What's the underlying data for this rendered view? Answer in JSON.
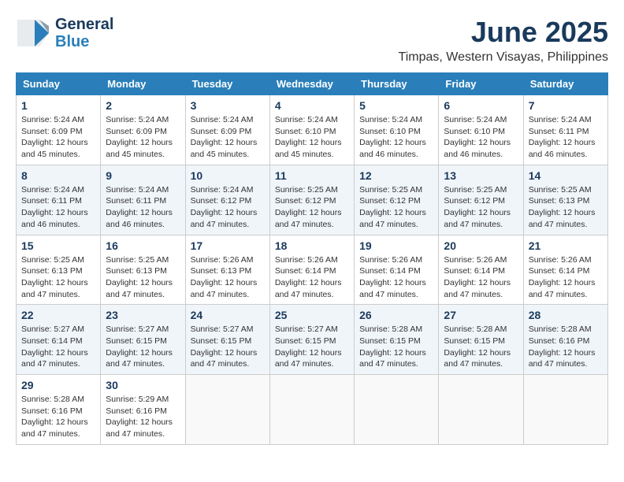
{
  "header": {
    "logo_general": "General",
    "logo_blue": "Blue",
    "month_title": "June 2025",
    "location": "Timpas, Western Visayas, Philippines"
  },
  "weekdays": [
    "Sunday",
    "Monday",
    "Tuesday",
    "Wednesday",
    "Thursday",
    "Friday",
    "Saturday"
  ],
  "weeks": [
    [
      {
        "day": "1",
        "sunrise": "5:24 AM",
        "sunset": "6:09 PM",
        "daylight": "12 hours and 45 minutes."
      },
      {
        "day": "2",
        "sunrise": "5:24 AM",
        "sunset": "6:09 PM",
        "daylight": "12 hours and 45 minutes."
      },
      {
        "day": "3",
        "sunrise": "5:24 AM",
        "sunset": "6:09 PM",
        "daylight": "12 hours and 45 minutes."
      },
      {
        "day": "4",
        "sunrise": "5:24 AM",
        "sunset": "6:10 PM",
        "daylight": "12 hours and 45 minutes."
      },
      {
        "day": "5",
        "sunrise": "5:24 AM",
        "sunset": "6:10 PM",
        "daylight": "12 hours and 46 minutes."
      },
      {
        "day": "6",
        "sunrise": "5:24 AM",
        "sunset": "6:10 PM",
        "daylight": "12 hours and 46 minutes."
      },
      {
        "day": "7",
        "sunrise": "5:24 AM",
        "sunset": "6:11 PM",
        "daylight": "12 hours and 46 minutes."
      }
    ],
    [
      {
        "day": "8",
        "sunrise": "5:24 AM",
        "sunset": "6:11 PM",
        "daylight": "12 hours and 46 minutes."
      },
      {
        "day": "9",
        "sunrise": "5:24 AM",
        "sunset": "6:11 PM",
        "daylight": "12 hours and 46 minutes."
      },
      {
        "day": "10",
        "sunrise": "5:24 AM",
        "sunset": "6:12 PM",
        "daylight": "12 hours and 47 minutes."
      },
      {
        "day": "11",
        "sunrise": "5:25 AM",
        "sunset": "6:12 PM",
        "daylight": "12 hours and 47 minutes."
      },
      {
        "day": "12",
        "sunrise": "5:25 AM",
        "sunset": "6:12 PM",
        "daylight": "12 hours and 47 minutes."
      },
      {
        "day": "13",
        "sunrise": "5:25 AM",
        "sunset": "6:12 PM",
        "daylight": "12 hours and 47 minutes."
      },
      {
        "day": "14",
        "sunrise": "5:25 AM",
        "sunset": "6:13 PM",
        "daylight": "12 hours and 47 minutes."
      }
    ],
    [
      {
        "day": "15",
        "sunrise": "5:25 AM",
        "sunset": "6:13 PM",
        "daylight": "12 hours and 47 minutes."
      },
      {
        "day": "16",
        "sunrise": "5:25 AM",
        "sunset": "6:13 PM",
        "daylight": "12 hours and 47 minutes."
      },
      {
        "day": "17",
        "sunrise": "5:26 AM",
        "sunset": "6:13 PM",
        "daylight": "12 hours and 47 minutes."
      },
      {
        "day": "18",
        "sunrise": "5:26 AM",
        "sunset": "6:14 PM",
        "daylight": "12 hours and 47 minutes."
      },
      {
        "day": "19",
        "sunrise": "5:26 AM",
        "sunset": "6:14 PM",
        "daylight": "12 hours and 47 minutes."
      },
      {
        "day": "20",
        "sunrise": "5:26 AM",
        "sunset": "6:14 PM",
        "daylight": "12 hours and 47 minutes."
      },
      {
        "day": "21",
        "sunrise": "5:26 AM",
        "sunset": "6:14 PM",
        "daylight": "12 hours and 47 minutes."
      }
    ],
    [
      {
        "day": "22",
        "sunrise": "5:27 AM",
        "sunset": "6:14 PM",
        "daylight": "12 hours and 47 minutes."
      },
      {
        "day": "23",
        "sunrise": "5:27 AM",
        "sunset": "6:15 PM",
        "daylight": "12 hours and 47 minutes."
      },
      {
        "day": "24",
        "sunrise": "5:27 AM",
        "sunset": "6:15 PM",
        "daylight": "12 hours and 47 minutes."
      },
      {
        "day": "25",
        "sunrise": "5:27 AM",
        "sunset": "6:15 PM",
        "daylight": "12 hours and 47 minutes."
      },
      {
        "day": "26",
        "sunrise": "5:28 AM",
        "sunset": "6:15 PM",
        "daylight": "12 hours and 47 minutes."
      },
      {
        "day": "27",
        "sunrise": "5:28 AM",
        "sunset": "6:15 PM",
        "daylight": "12 hours and 47 minutes."
      },
      {
        "day": "28",
        "sunrise": "5:28 AM",
        "sunset": "6:16 PM",
        "daylight": "12 hours and 47 minutes."
      }
    ],
    [
      {
        "day": "29",
        "sunrise": "5:28 AM",
        "sunset": "6:16 PM",
        "daylight": "12 hours and 47 minutes."
      },
      {
        "day": "30",
        "sunrise": "5:29 AM",
        "sunset": "6:16 PM",
        "daylight": "12 hours and 47 minutes."
      },
      null,
      null,
      null,
      null,
      null
    ]
  ]
}
